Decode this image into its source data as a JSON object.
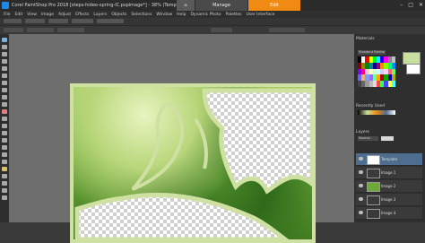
{
  "app": {
    "title": "Corel PaintShop Pro 2018 [steps-hideo-spring-IC.pspimage*] - 38% (Template)",
    "tabs": [
      {
        "label": "Manage"
      },
      {
        "label": "Edit"
      }
    ]
  },
  "menu": [
    "File",
    "Edit",
    "View",
    "Image",
    "Adjust",
    "Effects",
    "Layers",
    "Objects",
    "Selections",
    "Window",
    "Help",
    "Dynamic Photo",
    "Palettes",
    "User Interface"
  ],
  "palettes": {
    "materials_title": "Materials",
    "swatches_dropdown": "Standard Palette",
    "recent_title": "Recently Used",
    "layers_title": "Layers",
    "opacity_label": "Normal"
  },
  "layers": [
    {
      "name": "Template"
    },
    {
      "name": "Image 1"
    },
    {
      "name": "Image 2"
    },
    {
      "name": "Image 3"
    },
    {
      "name": "Image 4"
    }
  ],
  "colors": {
    "accent": "#f08a12",
    "frame_green": "#cfe0a3",
    "selected_layer": "#4f6e8f"
  }
}
